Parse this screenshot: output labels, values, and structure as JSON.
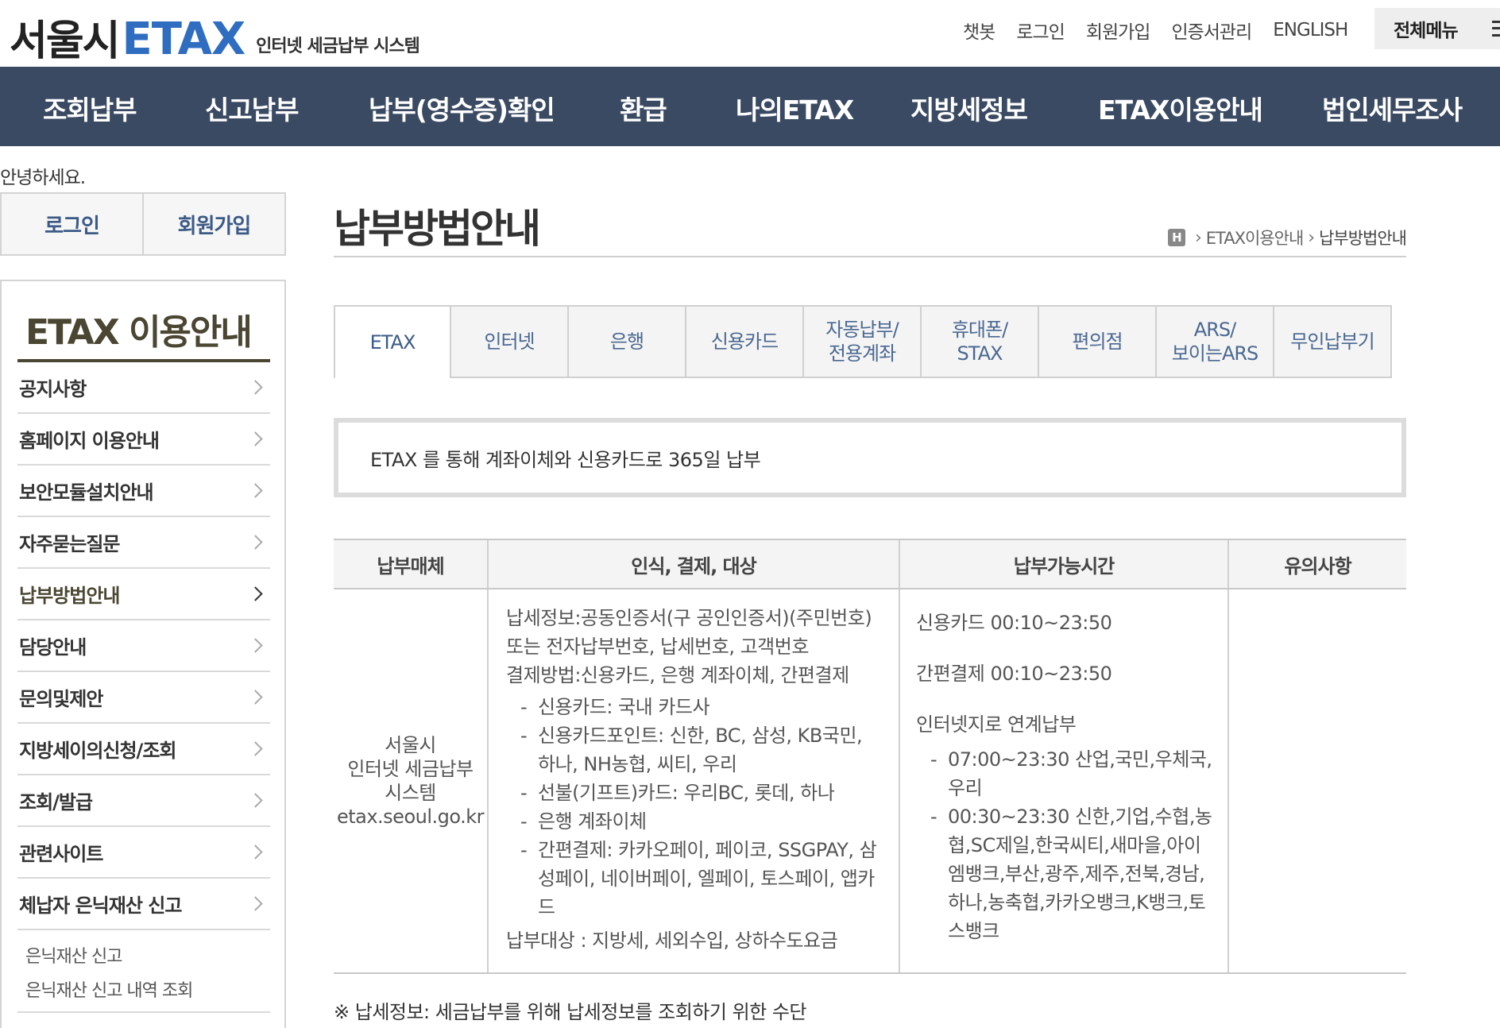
{
  "header": {
    "logo_seoul": "서울시",
    "logo_etax": "ETAX",
    "logo_sub": "인터넷 세금납부 시스템",
    "util_links": [
      "챗봇",
      "로그인",
      "회원가입",
      "인증서관리",
      "ENGLISH"
    ],
    "all_menu": "전체메뉴"
  },
  "gnb": [
    "조회납부",
    "신고납부",
    "납부(영수증)확인",
    "환급",
    "나의ETAX",
    "지방세정보",
    "ETAX이용안내",
    "법인세무조사"
  ],
  "greeting": "안녕하세요.",
  "login_box": {
    "login": "로그인",
    "join": "회원가입"
  },
  "lnb": {
    "title": "ETAX 이용안내",
    "items": [
      "공지사항",
      "홈페이지 이용안내",
      "보안모듈설치안내",
      "자주묻는질문",
      "납부방법안내",
      "담당안내",
      "문의및제안",
      "지방세이의신청/조회",
      "조회/발급",
      "관련사이트",
      "체납자 은닉재산 신고"
    ],
    "active_index": 4,
    "sub_items": [
      "은닉재산 신고",
      "은닉재산 신고 내역 조회"
    ]
  },
  "page": {
    "title": "납부방법안내",
    "breadcrumb_home": "H",
    "breadcrumb": [
      "ETAX이용안내",
      "납부방법안내"
    ]
  },
  "tabs": [
    "ETAX",
    "인터넷",
    "은행",
    "신용카드",
    "자동납부/\n전용계좌",
    "휴대폰/\nSTAX",
    "편의점",
    "ARS/\n보이는ARS",
    "무인납부기"
  ],
  "notice": "ETAX 를 통해 계좌이체와 신용카드로 365일 납부",
  "table": {
    "headers": [
      "납부매체",
      "인식, 결제, 대상",
      "납부가능시간",
      "유의사항"
    ],
    "media": [
      "서울시",
      "인터넷 세금납부",
      "시스템",
      "etax.seoul.go.kr"
    ],
    "info_top": [
      "납세정보:공동인증서(구 공인인증서)(주민번호)",
      "또는 전자납부번호, 납세번호, 고객번호",
      "결제방법:신용카드, 은행 계좌이체, 간편결제"
    ],
    "info_list": [
      "신용카드: 국내 카드사",
      "신용카드포인트: 신한, BC, 삼성, KB국민, 하나, NH농협, 씨티, 우리",
      "선불(기프트)카드: 우리BC, 롯데, 하나",
      "은행 계좌이체",
      "간편결제: 카카오페이, 페이코, SSGPAY, 삼성페이, 네이버페이, 엘페이, 토스페이, 앱카드"
    ],
    "info_bottom": "납부대상 : 지방세, 세외수입, 상하수도요금",
    "time_lines": [
      "신용카드 00:10~23:50",
      "간편결제 00:10~23:50",
      "인터넷지로 연계납부"
    ],
    "time_list": [
      "07:00~23:30 산업,국민,우체국, 우리",
      "00:30~23:30 신한,기업,수협,농협,SC제일,한국씨티,새마을,아이엠뱅크,부산,광주,제주,전북,경남,하나,농축협,카카오뱅크,K뱅크,토스뱅크"
    ],
    "note": ""
  },
  "footnote": "※ 납세정보: 세금납부를 위해 납세정보를 조회하기 위한 수단"
}
